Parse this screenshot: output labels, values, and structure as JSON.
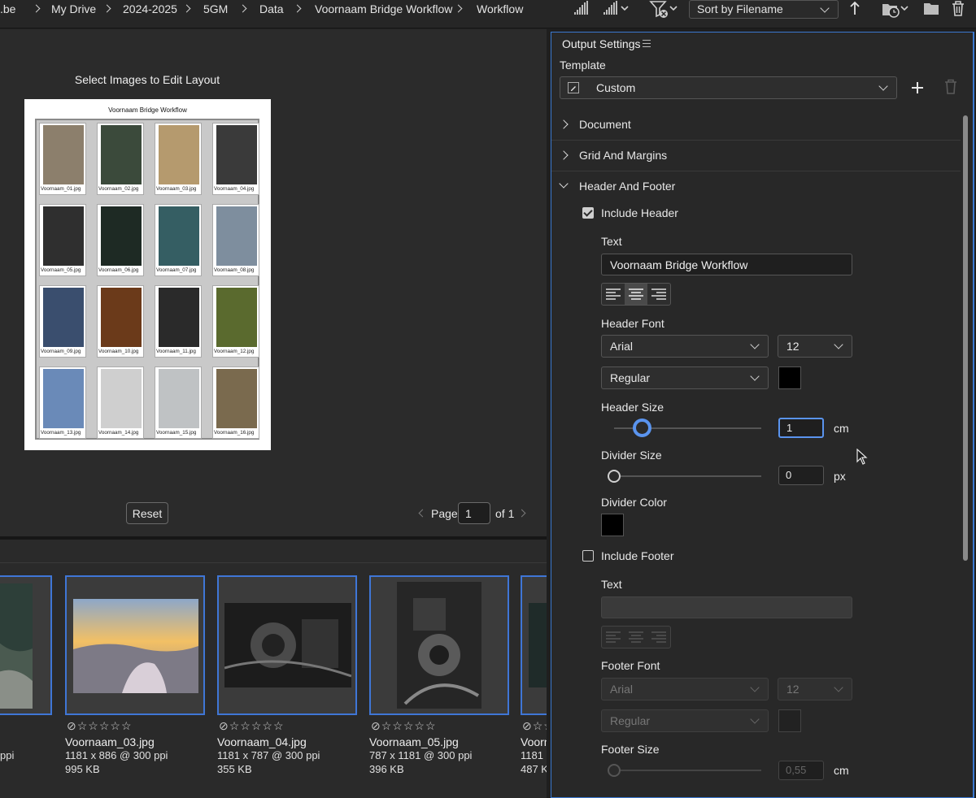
{
  "breadcrumb": {
    "items": [
      ".be",
      "My Drive",
      "2024-2025",
      "5GM",
      "Data",
      "Voornaam Bridge Workflow",
      "Workflow"
    ]
  },
  "toolbar": {
    "sort_label": "Sort by Filename",
    "icons": [
      "quality-low-icon",
      "quality-high-icon",
      "filter-icon",
      "sort-direction-icon",
      "open-recent-icon",
      "new-folder-icon",
      "delete-icon"
    ]
  },
  "preview": {
    "title": "Select Images to Edit Layout",
    "page_header": "Voornaam Bridge Workflow",
    "thumbnails": [
      {
        "caption": "Voornaam_01.jpg",
        "color": "#8c7f6c"
      },
      {
        "caption": "Voornaam_02.jpg",
        "color": "#3b4a3b"
      },
      {
        "caption": "Voornaam_03.jpg",
        "color": "#b59a6e"
      },
      {
        "caption": "Voornaam_04.jpg",
        "color": "#3a3a3a"
      },
      {
        "caption": "Voornaam_05.jpg",
        "color": "#2f2f2f"
      },
      {
        "caption": "Voornaam_06.jpg",
        "color": "#1e2a24"
      },
      {
        "caption": "Voornaam_07.jpg",
        "color": "#355e63"
      },
      {
        "caption": "Voornaam_08.jpg",
        "color": "#7e8e9e"
      },
      {
        "caption": "Voornaam_09.jpg",
        "color": "#3a4e6e"
      },
      {
        "caption": "Voornaam_10.jpg",
        "color": "#6b3a1a"
      },
      {
        "caption": "Voornaam_11.jpg",
        "color": "#2a2a2a"
      },
      {
        "caption": "Voornaam_12.jpg",
        "color": "#5a6a2e"
      },
      {
        "caption": "Voornaam_13.jpg",
        "color": "#6a8ab8"
      },
      {
        "caption": "Voornaam_14.jpg",
        "color": "#cfcfcf"
      },
      {
        "caption": "Voornaam_15.jpg",
        "color": "#bfc2c4"
      },
      {
        "caption": "Voornaam_16.jpg",
        "color": "#7a6a4e"
      }
    ],
    "reset_label": "Reset",
    "page_label": "Page",
    "page_value": "1",
    "of_label": "of 1"
  },
  "filmstrip": {
    "partial_left": {
      "meta1": "ppi"
    },
    "items": [
      {
        "name": "Voornaam_03.jpg",
        "dims": "1181 x 886 @ 300 ppi",
        "size": "995 KB"
      },
      {
        "name": "Voornaam_04.jpg",
        "dims": "1181 x 787 @ 300 ppi",
        "size": "355 KB"
      },
      {
        "name": "Voornaam_05.jpg",
        "dims": "787 x 1181 @ 300 ppi",
        "size": "396 KB"
      }
    ],
    "partial_right": {
      "name": "Voorn",
      "dims": "1181",
      "size": "487 K"
    },
    "stars": "☆☆☆☆☆",
    "reject": "⃠"
  },
  "output": {
    "title": "Output Settings",
    "template_label": "Template",
    "template_value": "Custom",
    "sections": {
      "document": "Document",
      "grid": "Grid And Margins",
      "header_footer": "Header And Footer"
    },
    "include_header": "Include Header",
    "header_text_label": "Text",
    "header_text_value": "Voornaam Bridge Workflow",
    "header_font_label": "Header Font",
    "header_font": "Arial",
    "header_font_size": "12",
    "header_font_style": "Regular",
    "header_size_label": "Header Size",
    "header_size_value": "1",
    "header_size_unit": "cm",
    "divider_size_label": "Divider Size",
    "divider_size_value": "0",
    "divider_size_unit": "px",
    "divider_color_label": "Divider Color",
    "include_footer": "Include Footer",
    "footer_text_label": "Text",
    "footer_text_value": "",
    "footer_font_label": "Footer Font",
    "footer_font": "Arial",
    "footer_font_size": "12",
    "footer_font_style": "Regular",
    "footer_size_label": "Footer Size",
    "footer_size_value": "0,55",
    "footer_size_unit": "cm"
  },
  "colors": {
    "accent": "#3f76d6",
    "panel_bg": "#282828",
    "preview_bg": "#2b2b2b"
  }
}
